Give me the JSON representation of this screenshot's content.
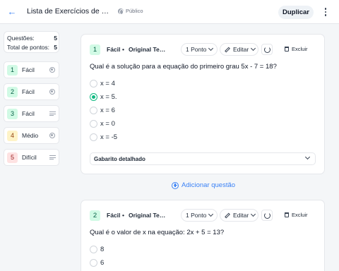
{
  "header": {
    "back_icon": "arrow-left-icon",
    "title": "Lista de Exercícios de Equações",
    "visibility": "Público",
    "duplicate_label": "Duplicar",
    "more_icon": "more-vertical-icon"
  },
  "sidebar": {
    "questions_label": "Questões:",
    "questions_count": "5",
    "points_label": "Total de pontos:",
    "points_count": "5",
    "items": [
      {
        "num": "1",
        "label": "Fácil",
        "icon": "radio-icon"
      },
      {
        "num": "2",
        "label": "Fácil",
        "icon": "radio-icon"
      },
      {
        "num": "3",
        "label": "Fácil",
        "icon": "text-lines-icon"
      },
      {
        "num": "4",
        "label": "Médio",
        "icon": "radio-icon"
      },
      {
        "num": "5",
        "label": "Difícil",
        "icon": "text-lines-icon"
      }
    ]
  },
  "questions": [
    {
      "num": "1",
      "level": "Fácil",
      "source": "Original Teacher",
      "points": "1 Ponto",
      "edit": "Editar",
      "delete": "Excluir",
      "text": "Qual é a solução para a equação do primeiro grau 5x - 7 = 18?",
      "options": [
        "x = 4",
        "x = 5.",
        "x = 6",
        "x = 0",
        "x = -5"
      ],
      "selected_index": 1,
      "answer_key": "Gabarito detalhado"
    },
    {
      "num": "2",
      "level": "Fácil",
      "source": "Original Teacher",
      "points": "1 Ponto",
      "edit": "Editar",
      "delete": "Excluir",
      "text": "Qual é o valor de x na equação: 2x + 5 = 13?",
      "options": [
        "8",
        "6"
      ]
    }
  ],
  "add_question": "Adicionar questão",
  "colors": {
    "accent": "#3b82f6",
    "selected": "#10b981",
    "easy": "#d1fae5",
    "medium": "#fef3c7",
    "hard": "#fee2e2"
  }
}
